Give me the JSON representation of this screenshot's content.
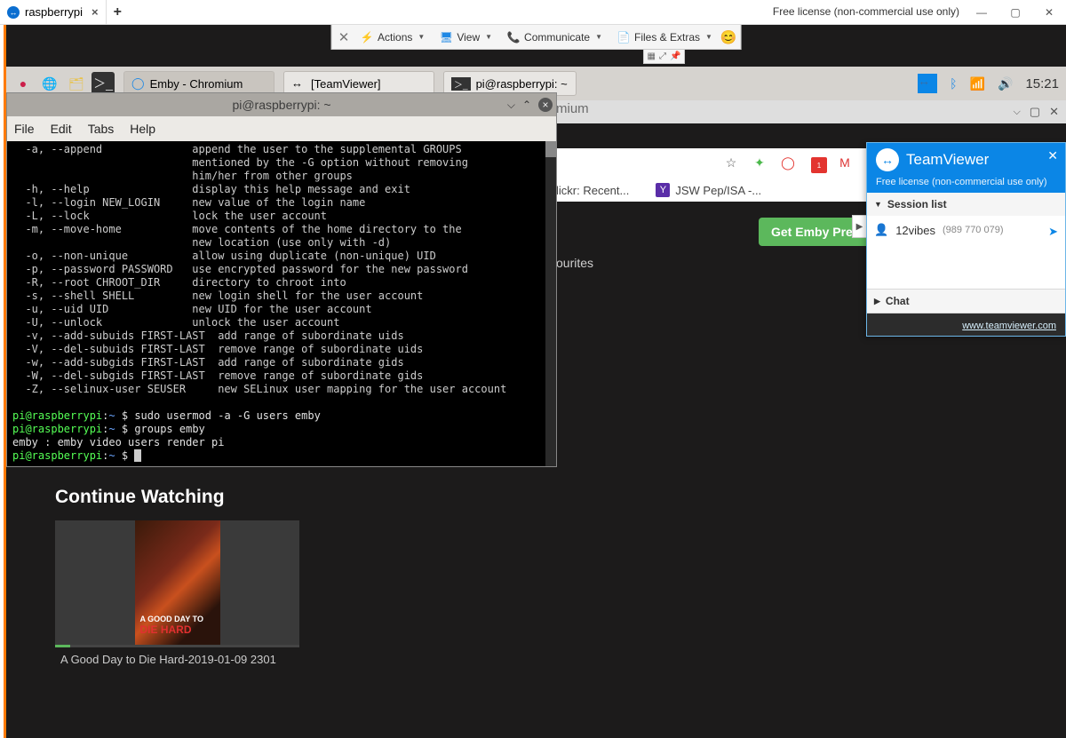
{
  "host": {
    "tab_label": "raspberrypi",
    "license_text": "Free license (non-commercial use only)"
  },
  "tv_toolbar": {
    "actions": "Actions",
    "view": "View",
    "communicate": "Communicate",
    "files_extras": "Files & Extras"
  },
  "rpi": {
    "task_chromium": "Emby - Chromium",
    "task_teamviewer": "[TeamViewer]",
    "task_terminal": "pi@raspberrypi: ~",
    "time": "15:21"
  },
  "chrome": {
    "window_title": "mium",
    "bookmark_flickr": "lickr: Recent...",
    "bookmark_jsw": "JSW Pep/ISA -..."
  },
  "emby": {
    "favorites_fragment": "ourites",
    "get_premiere": "Get Emby Pren",
    "continue_watching": "Continue Watching",
    "cw_item_title": "A Good Day to Die Hard-2019-01-09 2301",
    "poster_top": "A GOOD DAY TO",
    "poster_main": "DIE HARD"
  },
  "terminal": {
    "title": "pi@raspberrypi: ~",
    "menu": {
      "file": "File",
      "edit": "Edit",
      "tabs": "Tabs",
      "help": "Help"
    },
    "lines": [
      "  -a, --append              append the user to the supplemental GROUPS",
      "                            mentioned by the -G option without removing",
      "                            him/her from other groups",
      "  -h, --help                display this help message and exit",
      "  -l, --login NEW_LOGIN     new value of the login name",
      "  -L, --lock                lock the user account",
      "  -m, --move-home           move contents of the home directory to the",
      "                            new location (use only with -d)",
      "  -o, --non-unique          allow using duplicate (non-unique) UID",
      "  -p, --password PASSWORD   use encrypted password for the new password",
      "  -R, --root CHROOT_DIR     directory to chroot into",
      "  -s, --shell SHELL         new login shell for the user account",
      "  -u, --uid UID             new UID for the user account",
      "  -U, --unlock              unlock the user account",
      "  -v, --add-subuids FIRST-LAST  add range of subordinate uids",
      "  -V, --del-subuids FIRST-LAST  remove range of subordinate uids",
      "  -w, --add-subgids FIRST-LAST  add range of subordinate gids",
      "  -W, --del-subgids FIRST-LAST  remove range of subordinate gids",
      "  -Z, --selinux-user SEUSER     new SELinux user mapping for the user account",
      ""
    ],
    "prompt_user": "pi@raspberrypi",
    "prompt_sep": ":",
    "prompt_path": "~",
    "prompt_dollar": " $ ",
    "cmd1": "sudo usermod -a -G users emby",
    "cmd2": "groups emby",
    "out2": "emby : emby video users render pi"
  },
  "tv_panel": {
    "brand": "TeamViewer",
    "license": "Free license (non-commercial use only)",
    "session_list": "Session list",
    "session_name": "12vibes",
    "session_id": "(989 770 079)",
    "chat": "Chat",
    "url": "www.teamviewer.com"
  }
}
